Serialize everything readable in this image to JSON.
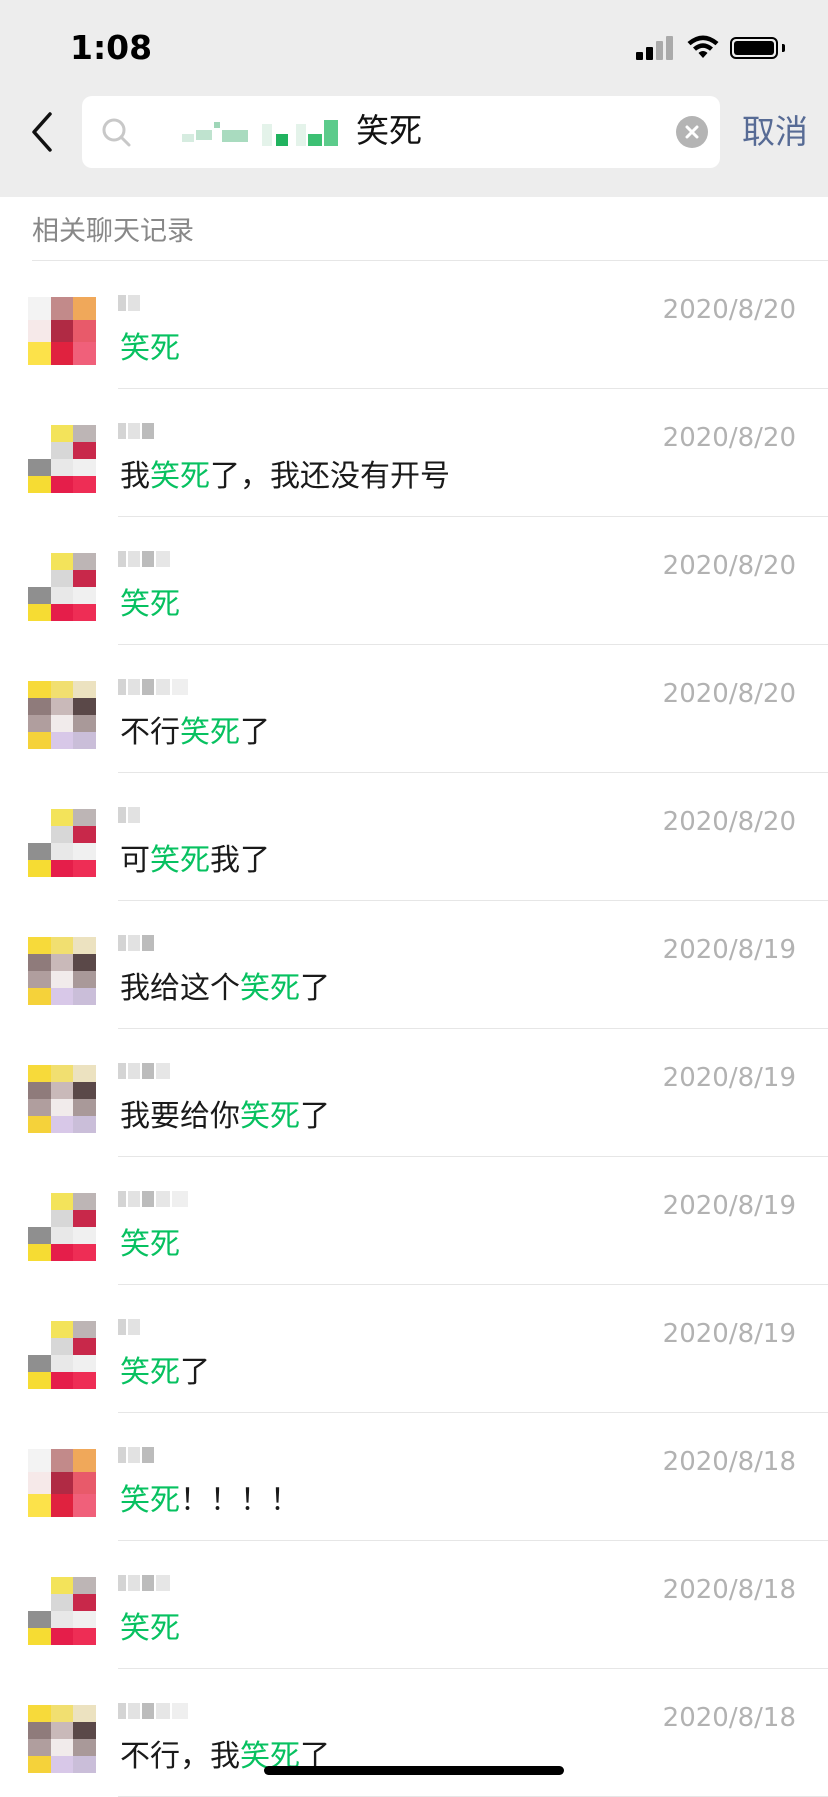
{
  "status_bar": {
    "time": "1:08"
  },
  "search": {
    "query": "笑死",
    "cancel_label": "取消"
  },
  "section_title": "相关聊天记录",
  "colors": {
    "highlight": "#07c160",
    "link": "#576b95",
    "muted": "#b2b2b2"
  },
  "results": [
    {
      "avatar": "a",
      "date": "2020/8/20",
      "pre": "",
      "hl": "笑死",
      "post": ""
    },
    {
      "avatar": "b",
      "date": "2020/8/20",
      "pre": "我",
      "hl": "笑死",
      "post": "了，我还没有开号"
    },
    {
      "avatar": "b",
      "date": "2020/8/20",
      "pre": "",
      "hl": "笑死",
      "post": ""
    },
    {
      "avatar": "c",
      "date": "2020/8/20",
      "pre": "不行",
      "hl": "笑死",
      "post": "了"
    },
    {
      "avatar": "b",
      "date": "2020/8/20",
      "pre": "可",
      "hl": "笑死",
      "post": "我了"
    },
    {
      "avatar": "c",
      "date": "2020/8/19",
      "pre": "我给这个",
      "hl": "笑死",
      "post": "了"
    },
    {
      "avatar": "c",
      "date": "2020/8/19",
      "pre": "我要给你",
      "hl": "笑死",
      "post": "了"
    },
    {
      "avatar": "b",
      "date": "2020/8/19",
      "pre": "",
      "hl": "笑死",
      "post": ""
    },
    {
      "avatar": "b",
      "date": "2020/8/19",
      "pre": "",
      "hl": "笑死",
      "post": "了"
    },
    {
      "avatar": "a",
      "date": "2020/8/18",
      "pre": "",
      "hl": "笑死",
      "post": "！！！！"
    },
    {
      "avatar": "b",
      "date": "2020/8/18",
      "pre": "",
      "hl": "笑死",
      "post": ""
    },
    {
      "avatar": "c",
      "date": "2020/8/18",
      "pre": "不行，我",
      "hl": "笑死",
      "post": "了"
    }
  ]
}
